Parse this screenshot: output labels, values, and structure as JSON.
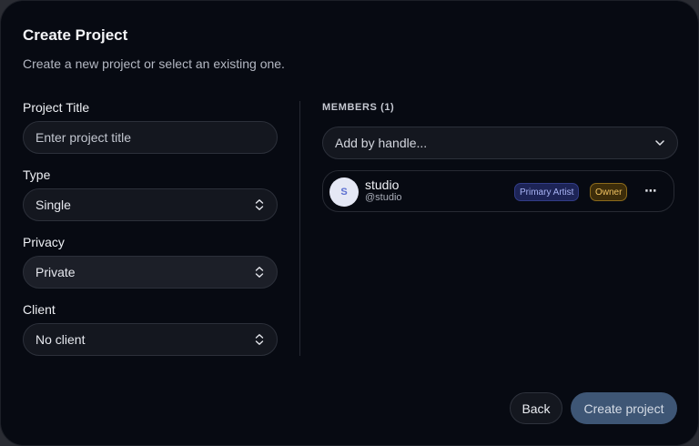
{
  "dialog": {
    "title": "Create Project",
    "subtitle": "Create a new project or select an existing one."
  },
  "form": {
    "project_title": {
      "label": "Project Title",
      "value": "",
      "placeholder": "Enter project title"
    },
    "type": {
      "label": "Type",
      "value": "Single",
      "icon": "chevron-up-down-icon"
    },
    "privacy": {
      "label": "Privacy",
      "value": "Private",
      "icon": "chevron-up-down-icon"
    },
    "client": {
      "label": "Client",
      "value": "No client",
      "icon": "chevron-up-down-icon"
    }
  },
  "members": {
    "heading": "MEMBERS (1)",
    "add_placeholder": "Add by handle...",
    "add_icon": "chevron-down-icon",
    "list": [
      {
        "avatar_initial": "S",
        "name": "studio",
        "handle": "@studio",
        "roles": [
          "Primary Artist",
          "Owner"
        ],
        "menu": "⋯"
      }
    ]
  },
  "actions": {
    "back_label": "Back",
    "create_label": "Create project"
  },
  "colors": {
    "background": "#070a12",
    "primary_button": "#3e5675",
    "artist_badge": "#1d2456",
    "owner_badge": "#3d2d0a",
    "avatar": "#e5e8f5"
  }
}
